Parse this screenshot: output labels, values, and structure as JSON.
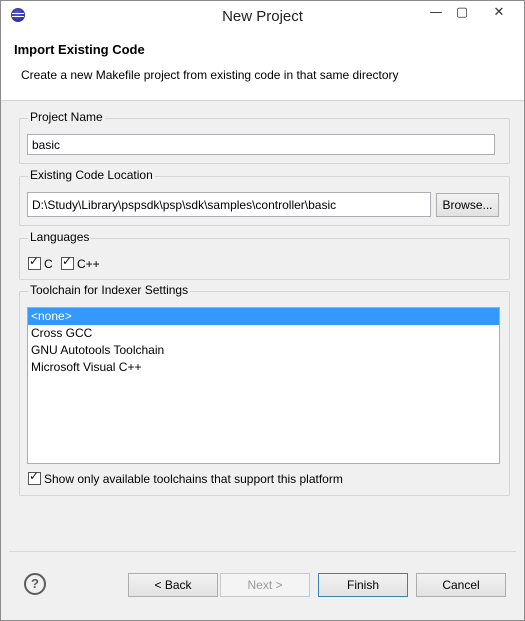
{
  "window": {
    "title": "New Project",
    "controls": {
      "minimize": "—",
      "maximize": "▢",
      "close": "✕"
    }
  },
  "header": {
    "title": "Import Existing Code",
    "description": "Create a new Makefile project from existing code in that same directory"
  },
  "project_name": {
    "label": "Project Name",
    "value": "basic"
  },
  "code_location": {
    "label": "Existing Code Location",
    "value": "D:\\Study\\Library\\pspsdk\\psp\\sdk\\samples\\controller\\basic",
    "browse_label": "Browse..."
  },
  "languages": {
    "label": "Languages",
    "items": [
      {
        "label": "C",
        "checked": true
      },
      {
        "label": "C++",
        "checked": true
      }
    ]
  },
  "toolchain": {
    "label": "Toolchain for Indexer Settings",
    "items": [
      "<none>",
      "Cross GCC",
      "GNU Autotools Toolchain",
      "Microsoft Visual C++"
    ],
    "selected_index": 0,
    "filter_label": "Show only available toolchains that support this platform",
    "filter_checked": true
  },
  "footer": {
    "help_glyph": "?",
    "back_label": "< Back",
    "next_label": "Next >",
    "finish_label": "Finish",
    "cancel_label": "Cancel"
  },
  "colors": {
    "selection": "#3399ff",
    "dialog_bg": "#f0f0f0"
  }
}
